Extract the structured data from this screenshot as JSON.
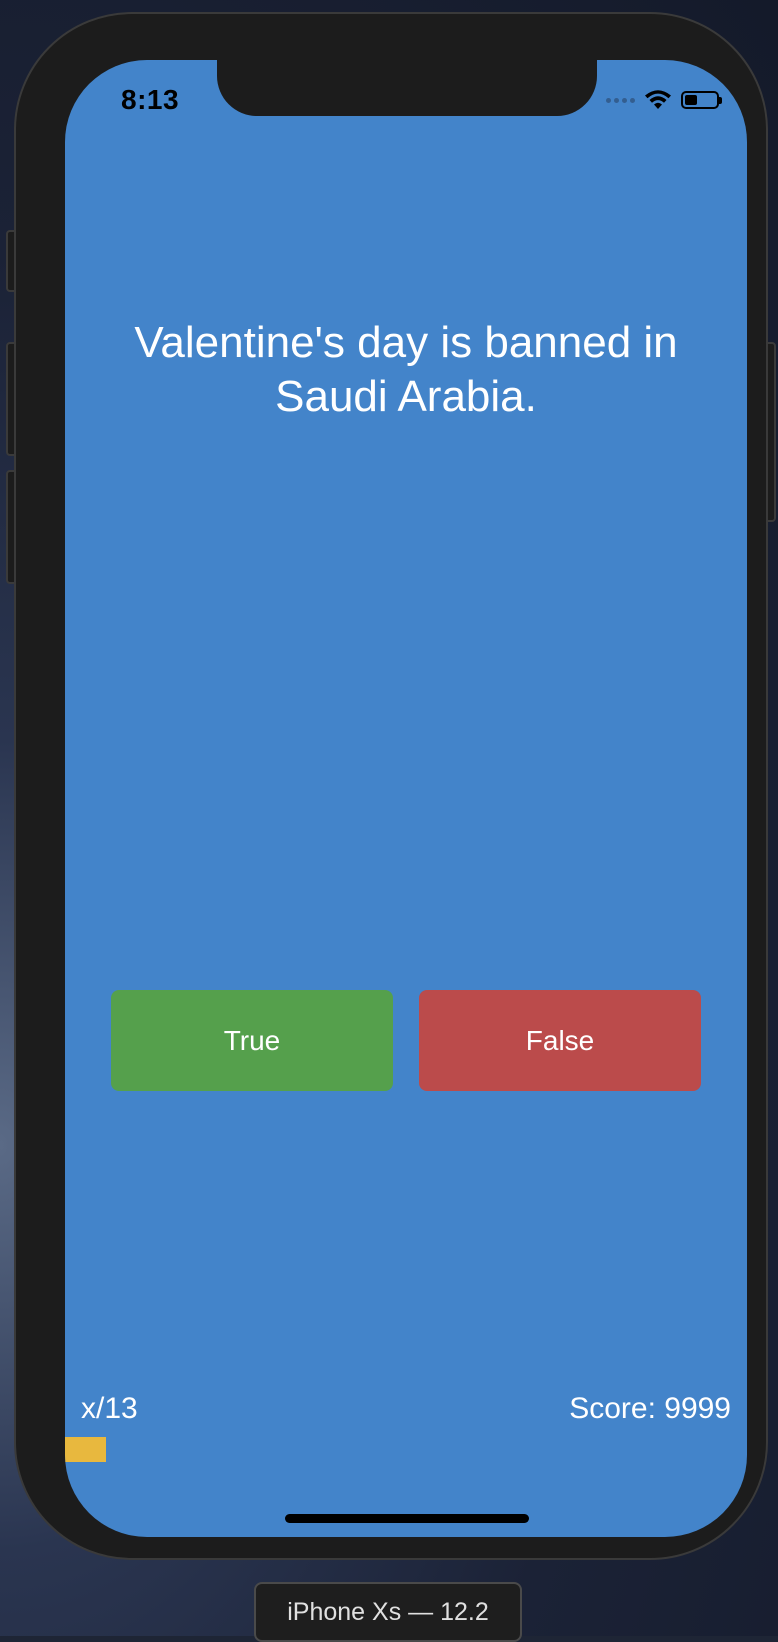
{
  "status_bar": {
    "time": "8:13"
  },
  "question": {
    "text": "Valentine's day is banned in Saudi Arabia."
  },
  "answers": {
    "true_label": "True",
    "false_label": "False"
  },
  "footer": {
    "progress_label": "x/13",
    "score_label": "Score: 9999",
    "progress_fraction": 0.06
  },
  "simulator": {
    "device_label": "iPhone Xs — 12.2"
  },
  "colors": {
    "background": "#4384ca",
    "true_button": "#55a04c",
    "false_button": "#bb4b4b",
    "progress_bar": "#e8b83e"
  }
}
